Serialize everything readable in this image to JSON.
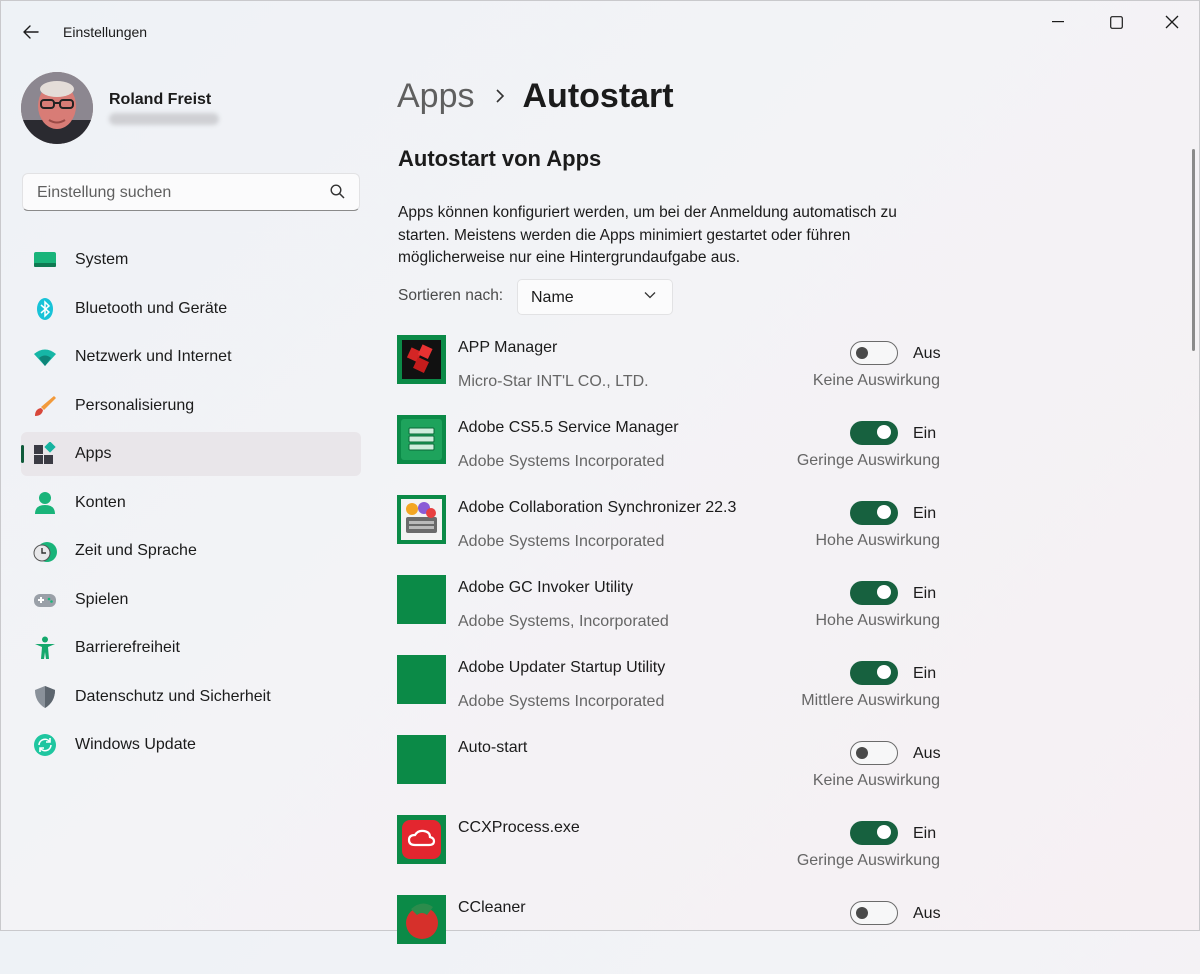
{
  "window": {
    "title": "Einstellungen",
    "controls": [
      "minimize-icon",
      "maximize-icon",
      "close-icon"
    ]
  },
  "profile": {
    "name": "Roland Freist"
  },
  "search": {
    "placeholder": "Einstellung suchen"
  },
  "sidebar": {
    "items": [
      {
        "label": "System",
        "icon": "system-icon"
      },
      {
        "label": "Bluetooth und Geräte",
        "icon": "bluetooth-icon"
      },
      {
        "label": "Netzwerk und Internet",
        "icon": "network-icon"
      },
      {
        "label": "Personalisierung",
        "icon": "brush-icon"
      },
      {
        "label": "Apps",
        "icon": "apps-icon",
        "active": true
      },
      {
        "label": "Konten",
        "icon": "account-icon"
      },
      {
        "label": "Zeit und Sprache",
        "icon": "clock-globe-icon"
      },
      {
        "label": "Spielen",
        "icon": "gamepad-icon"
      },
      {
        "label": "Barrierefreiheit",
        "icon": "accessibility-icon"
      },
      {
        "label": "Datenschutz und Sicherheit",
        "icon": "shield-icon"
      },
      {
        "label": "Windows Update",
        "icon": "update-icon"
      }
    ]
  },
  "breadcrumb": {
    "parent": "Apps",
    "current": "Autostart"
  },
  "section": {
    "title": "Autostart von Apps",
    "description": "Apps können konfiguriert werden, um bei der Anmeldung automatisch zu starten. Meistens werden die Apps minimiert gestartet oder führen möglicherweise nur eine Hintergrundaufgabe aus."
  },
  "sort": {
    "label": "Sortieren nach:",
    "value": "Name"
  },
  "apps": [
    {
      "name": "APP Manager",
      "publisher": "Micro-Star INT'L CO., LTD.",
      "enabled": false,
      "state": "Aus",
      "impact": "Keine Auswirkung",
      "icon": "app-manager-icon"
    },
    {
      "name": "Adobe CS5.5 Service Manager",
      "publisher": "Adobe Systems Incorporated",
      "enabled": true,
      "state": "Ein",
      "impact": "Geringe Auswirkung",
      "icon": "adobe-service-manager-icon"
    },
    {
      "name": "Adobe Collaboration Synchronizer 22.3",
      "publisher": "Adobe Systems Incorporated",
      "enabled": true,
      "state": "Ein",
      "impact": "Hohe Auswirkung",
      "icon": "adobe-sync-icon"
    },
    {
      "name": "Adobe GC Invoker Utility",
      "publisher": "Adobe Systems, Incorporated",
      "enabled": true,
      "state": "Ein",
      "impact": "Hohe Auswirkung",
      "icon": "generic-app-icon"
    },
    {
      "name": "Adobe Updater Startup Utility",
      "publisher": "Adobe Systems Incorporated",
      "enabled": true,
      "state": "Ein",
      "impact": "Mittlere Auswirkung",
      "icon": "generic-app-icon"
    },
    {
      "name": "Auto-start",
      "publisher": "",
      "enabled": false,
      "state": "Aus",
      "impact": "Keine Auswirkung",
      "icon": "generic-app-icon"
    },
    {
      "name": "CCXProcess.exe",
      "publisher": "",
      "enabled": true,
      "state": "Ein",
      "impact": "Geringe Auswirkung",
      "icon": "creative-cloud-icon"
    },
    {
      "name": "CCleaner",
      "publisher": "",
      "enabled": false,
      "state": "Aus",
      "impact": "",
      "icon": "ccleaner-icon"
    }
  ],
  "colors": {
    "accent": "#17613f",
    "app_tile": "#0b8a47"
  }
}
